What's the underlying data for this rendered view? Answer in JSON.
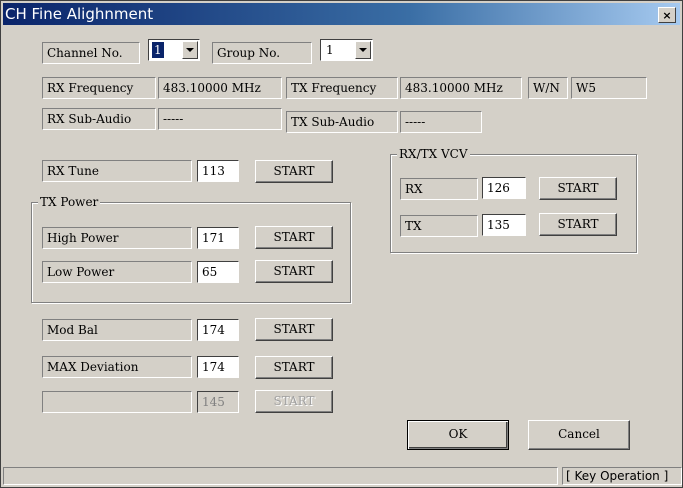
{
  "window": {
    "title": "CH Fine Alighnment",
    "close_glyph": "×"
  },
  "channel": {
    "label": "Channel No.",
    "value": "1"
  },
  "group": {
    "label": "Group No.",
    "value": "1"
  },
  "rx_frequency": {
    "label": "RX Frequency",
    "value": "483.10000 MHz"
  },
  "tx_frequency": {
    "label": "TX Frequency",
    "value": "483.10000 MHz"
  },
  "wn": {
    "label": "W/N",
    "value": "W5"
  },
  "rx_sub_audio": {
    "label": "RX Sub-Audio",
    "value": "-----"
  },
  "tx_sub_audio": {
    "label": "TX Sub-Audio",
    "value": "-----"
  },
  "rx_tune": {
    "label": "RX Tune",
    "value": "113",
    "button": "START"
  },
  "tx_power": {
    "title": "TX Power",
    "high": {
      "label": "High Power",
      "value": "171",
      "button": "START"
    },
    "low": {
      "label": "Low Power",
      "value": "65",
      "button": "START"
    }
  },
  "mod_bal": {
    "label": "Mod Bal",
    "value": "174",
    "button": "START"
  },
  "max_deviation": {
    "label": "MAX Deviation",
    "value": "174",
    "button": "START"
  },
  "extra_row": {
    "label": "",
    "value": "145",
    "button": "START"
  },
  "vcv": {
    "title": "RX/TX VCV",
    "rx": {
      "label": "RX",
      "value": "126",
      "button": "START"
    },
    "tx": {
      "label": "TX",
      "value": "135",
      "button": "START"
    }
  },
  "dialog": {
    "ok": "OK",
    "cancel": "Cancel"
  },
  "status": {
    "main": "",
    "right": "[ Key Operation ]"
  }
}
